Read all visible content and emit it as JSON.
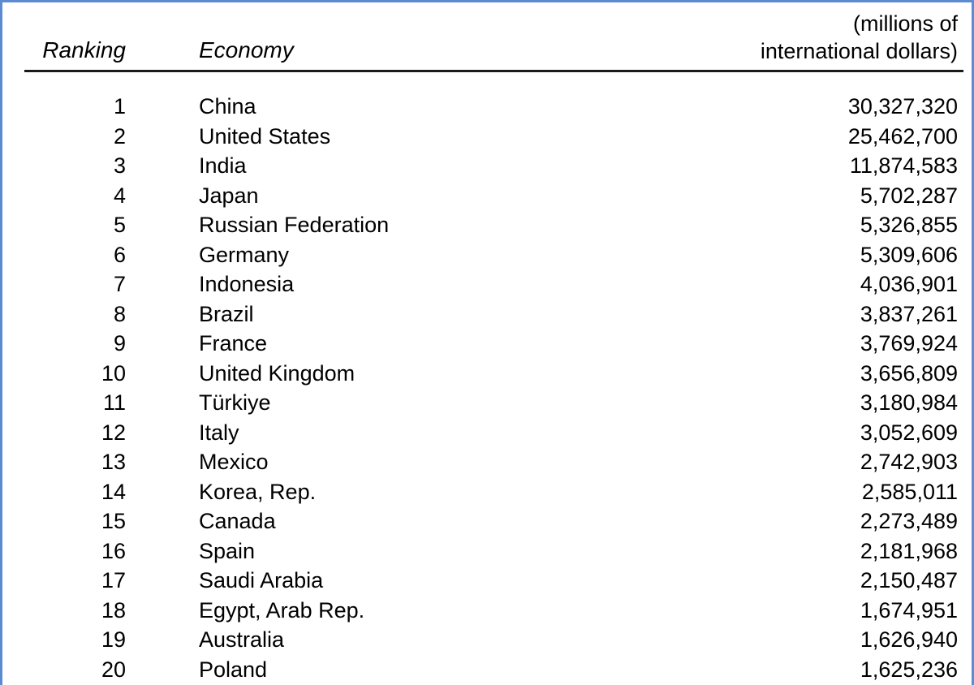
{
  "table": {
    "headers": {
      "ranking": "Ranking",
      "economy": "Economy",
      "units_line1": "(millions of",
      "units_line2": "international dollars)"
    },
    "columns": [
      "Ranking",
      "Economy",
      "(millions of international dollars)"
    ],
    "rows": [
      {
        "rank": "1",
        "economy": "China",
        "value": "30,327,320"
      },
      {
        "rank": "2",
        "economy": "United States",
        "value": "25,462,700"
      },
      {
        "rank": "3",
        "economy": "India",
        "value": "11,874,583"
      },
      {
        "rank": "4",
        "economy": "Japan",
        "value": "5,702,287"
      },
      {
        "rank": "5",
        "economy": "Russian Federation",
        "value": "5,326,855"
      },
      {
        "rank": "6",
        "economy": "Germany",
        "value": "5,309,606"
      },
      {
        "rank": "7",
        "economy": "Indonesia",
        "value": "4,036,901"
      },
      {
        "rank": "8",
        "economy": "Brazil",
        "value": "3,837,261"
      },
      {
        "rank": "9",
        "economy": "France",
        "value": "3,769,924"
      },
      {
        "rank": "10",
        "economy": "United Kingdom",
        "value": "3,656,809"
      },
      {
        "rank": "11",
        "economy": "Türkiye",
        "value": "3,180,984"
      },
      {
        "rank": "12",
        "economy": "Italy",
        "value": "3,052,609"
      },
      {
        "rank": "13",
        "economy": "Mexico",
        "value": "2,742,903"
      },
      {
        "rank": "14",
        "economy": "Korea, Rep.",
        "value": "2,585,011"
      },
      {
        "rank": "15",
        "economy": "Canada",
        "value": "2,273,489"
      },
      {
        "rank": "16",
        "economy": "Spain",
        "value": "2,181,968"
      },
      {
        "rank": "17",
        "economy": "Saudi Arabia",
        "value": "2,150,487"
      },
      {
        "rank": "18",
        "economy": "Egypt, Arab Rep.",
        "value": "1,674,951"
      },
      {
        "rank": "19",
        "economy": "Australia",
        "value": "1,626,940"
      },
      {
        "rank": "20",
        "economy": "Poland",
        "value": "1,625,236"
      }
    ]
  },
  "colors": {
    "border": "#5b8bd0",
    "rule": "#1a1a1a",
    "text": "#000000",
    "background": "#ffffff"
  }
}
